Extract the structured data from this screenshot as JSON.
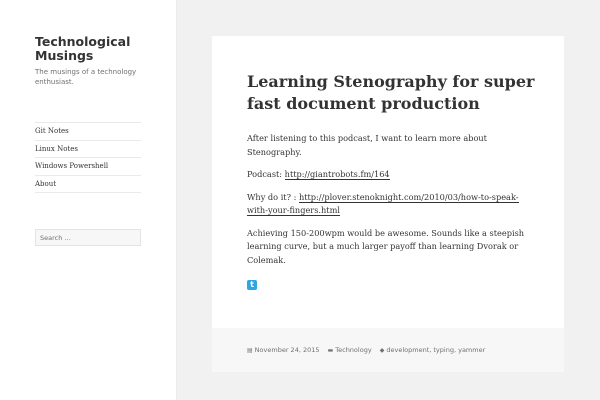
{
  "site": {
    "title": "Technological Musings",
    "description": "The musings of a technology enthusiast."
  },
  "nav": {
    "items": [
      {
        "label": "Git Notes"
      },
      {
        "label": "Linux Notes"
      },
      {
        "label": "Windows Powershell"
      },
      {
        "label": "About"
      }
    ]
  },
  "search": {
    "placeholder": "Search …"
  },
  "post": {
    "title": "Learning Stenography for super fast document production",
    "p1": "After listening to this podcast, I want to learn more about Stenography.",
    "podcast_label": "Podcast: ",
    "podcast_link": "http://giantrobots.fm/164",
    "why_label": "Why do it? : ",
    "why_link": "http://plover.stenoknight.com/2010/03/how-to-speak-with-your-fingers.html",
    "p4": "Achieving 150-200wpm would be awesome. Sounds like a steepish learning curve, but a much larger payoff than learning Dvorak or Colemak."
  },
  "footer": {
    "date": "November 24, 2015",
    "category": "Technology",
    "tags": "development, typing, yammer"
  },
  "colors": {
    "twitter": "#2ea6e0"
  }
}
